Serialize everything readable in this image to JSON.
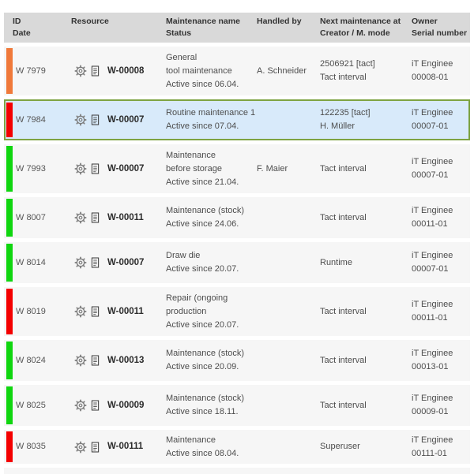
{
  "header": {
    "columns": [
      {
        "line1": "ID",
        "line2": "Date"
      },
      {
        "line1": "Resource",
        "line2": ""
      },
      {
        "line1": "Maintenance name",
        "line2": "Status"
      },
      {
        "line1": "Handled by",
        "line2": ""
      },
      {
        "line1": "Next maintenance at",
        "line2": "Creator / M. mode"
      },
      {
        "line1": "Owner",
        "line2": "Serial number"
      }
    ]
  },
  "colors": {
    "bar_orange": "#f0793a",
    "bar_red": "#f40000",
    "bar_green": "#0fd60f",
    "header_bg": "#d9d9d9",
    "row_bg": "#f6f6f6",
    "selected_row_bg": "#d8eafa",
    "selected_row_border": "#7ea342"
  },
  "icons": {
    "resource_action_1": "gear-icon",
    "resource_action_2": "document-icon"
  },
  "table": {
    "rows": [
      {
        "bar_style": "background:#f0793a",
        "id": "W 7979",
        "resource": "W-00008",
        "name1": "General",
        "name2": "tool maintenance",
        "status": "Active since 06.04.",
        "handled_by": "A. Schneider",
        "next1": "2506921 [tact]",
        "next2": "Tact interval",
        "owner": "iT Enginee",
        "serial": "00008-01",
        "selected": false
      },
      {
        "bar_style": "background:#f40000",
        "id": "W 7984",
        "resource": "W-00007",
        "name1": "Routine maintenance 1",
        "name2": "",
        "status": "Active since 07.04.",
        "handled_by": "",
        "next1": "122235 [tact]",
        "next2": "H. Müller",
        "owner": "iT Enginee",
        "serial": "00007-01",
        "selected": true
      },
      {
        "bar_style": "background:#0fd60f",
        "id": "W 7993",
        "resource": "W-00007",
        "name1": "Maintenance",
        "name2": "before storage",
        "status": "Active since 21.04.",
        "handled_by": "F. Maier",
        "next1": "Tact interval",
        "next2": "",
        "owner": "iT Enginee",
        "serial": "00007-01",
        "selected": false
      },
      {
        "bar_style": "background:#0fd60f",
        "id": "W 8007",
        "resource": "W-00011",
        "name1": "Maintenance (stock)",
        "name2": "",
        "status": "Active since 24.06.",
        "handled_by": "",
        "next1": "Tact interval",
        "next2": "",
        "owner": "iT Enginee",
        "serial": "00011-01",
        "selected": false
      },
      {
        "bar_style": "background:#0fd60f",
        "id": "W 8014",
        "resource": "W-00007",
        "name1": "Draw die",
        "name2": "",
        "status": "Active since 20.07.",
        "handled_by": "",
        "next1": "Runtime",
        "next2": "",
        "owner": "iT Enginee",
        "serial": "00007-01",
        "selected": false
      },
      {
        "bar_style": "background:#f40000",
        "id": "W 8019",
        "resource": "W-00011",
        "name1": "Repair (ongoing",
        "name2": "production",
        "status": "Active since 20.07.",
        "handled_by": "",
        "next1": "Tact interval",
        "next2": "",
        "owner": "iT Enginee",
        "serial": "00011-01",
        "selected": false
      },
      {
        "bar_style": "background:#0fd60f",
        "id": "W 8024",
        "resource": "W-00013",
        "name1": "Maintenance (stock)",
        "name2": "",
        "status": "Active since 20.09.",
        "handled_by": "",
        "next1": "Tact interval",
        "next2": "",
        "owner": "iT Enginee",
        "serial": "00013-01",
        "selected": false
      },
      {
        "bar_style": "background:#0fd60f",
        "id": "W 8025",
        "resource": "W-00009",
        "name1": "Maintenance (stock)",
        "name2": "",
        "status": "Active since 18.11.",
        "handled_by": "",
        "next1": "Tact interval",
        "next2": "",
        "owner": "iT Enginee",
        "serial": "00009-01",
        "selected": false
      },
      {
        "bar_style": "background:#f40000",
        "id": "W 8035",
        "resource": "W-00111",
        "name1": "Maintenance",
        "name2": "",
        "status": "Active since 08.04.",
        "handled_by": "",
        "next1": "Superuser",
        "next2": "",
        "owner": "iT Enginee",
        "serial": "00111-01",
        "selected": false
      }
    ]
  }
}
